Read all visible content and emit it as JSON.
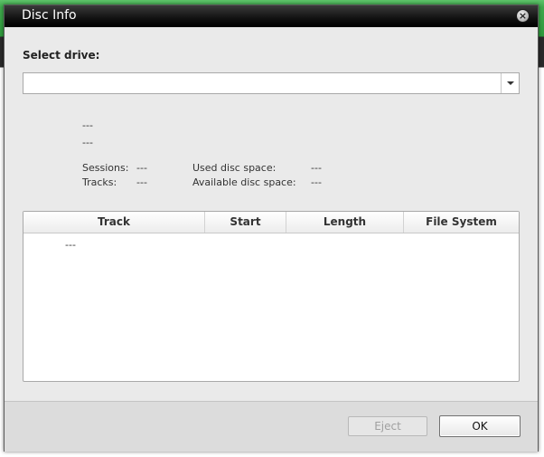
{
  "dialog": {
    "title": "Disc Info",
    "close_symbol": "×"
  },
  "select_drive": {
    "label": "Select drive:",
    "value": ""
  },
  "disc_info": {
    "line1": "---",
    "line2": "---",
    "sessions_label": "Sessions:",
    "sessions_value": "---",
    "tracks_label": "Tracks:",
    "tracks_value": "---",
    "used_space_label": "Used disc space:",
    "used_space_value": "---",
    "available_space_label": "Available disc space:",
    "available_space_value": "---"
  },
  "table": {
    "columns": [
      "Track",
      "Start",
      "Length",
      "File System"
    ],
    "rows": [
      {
        "track": "---"
      }
    ]
  },
  "buttons": {
    "eject": "Eject",
    "ok": "OK"
  }
}
